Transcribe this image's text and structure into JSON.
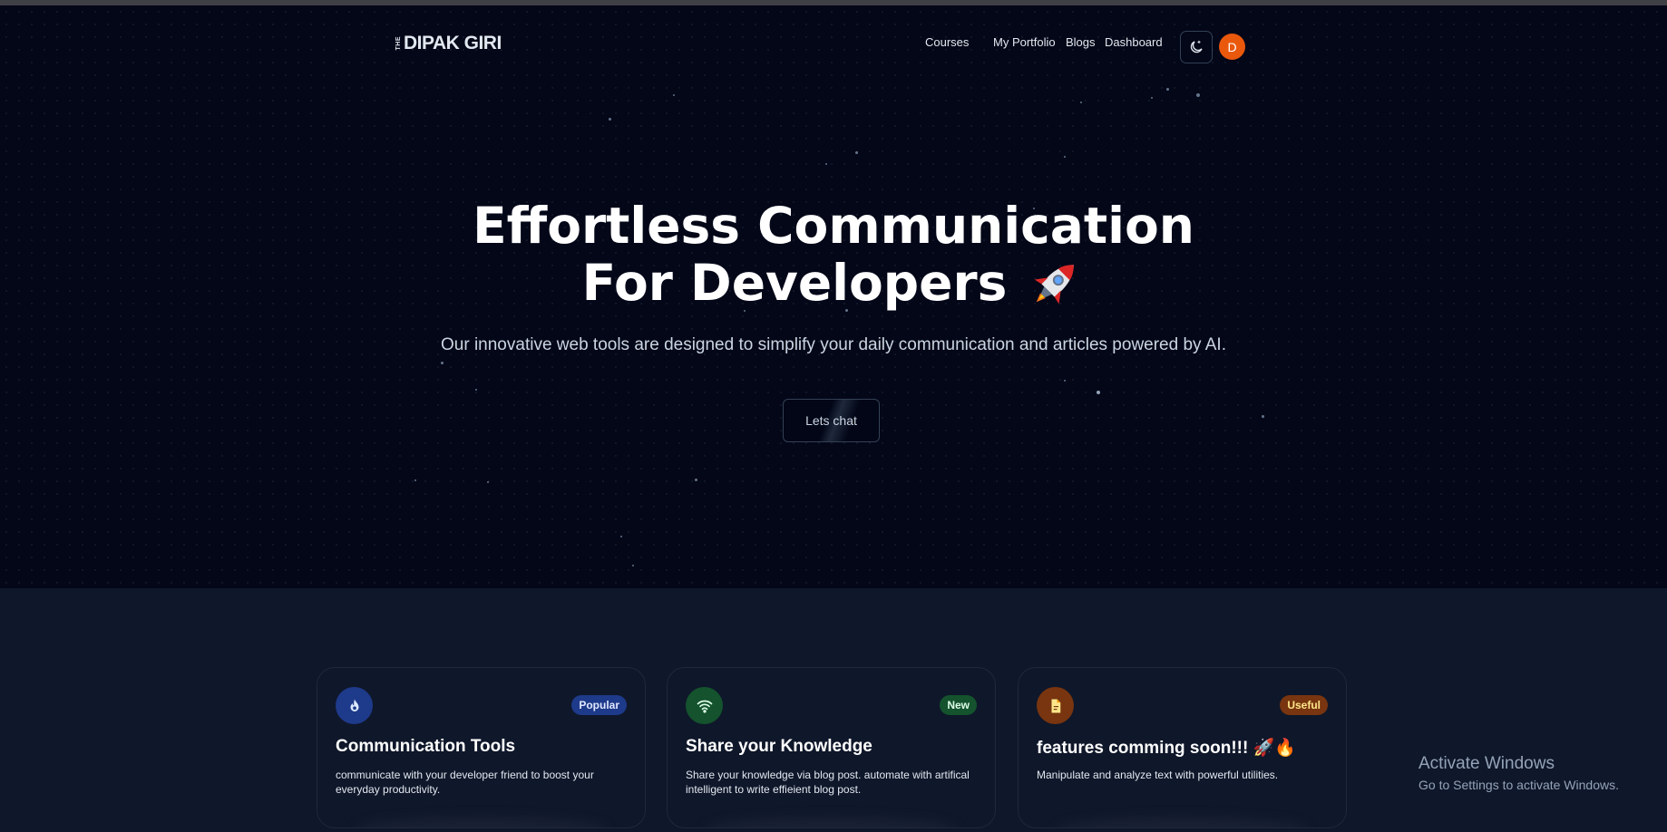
{
  "app": {
    "logo_prefix": "THE",
    "logo_text": "DIPAK GIRI"
  },
  "nav": {
    "links": [
      "Courses",
      "My Portfolio",
      "Blogs",
      "Dashboard"
    ],
    "theme_toggle_icon": "moon-icon",
    "avatar_initial": "D"
  },
  "hero": {
    "title_line1": "Effortless Communication",
    "title_line2": "For Developers",
    "title_emoji_icon": "rocket-icon",
    "subtitle": "Our innovative web tools are designed to simplify your daily communication and articles powered by AI.",
    "cta_label": "Lets chat"
  },
  "cards": [
    {
      "icon": "flame-icon",
      "icon_bg": "#1e3a8a",
      "badge": "Popular",
      "badge_bg": "#1e3a8a",
      "badge_color": "#e0e7ff",
      "title": "Communication Tools",
      "description": "communicate with your developer friend to boost your everyday productivity."
    },
    {
      "icon": "wifi-icon",
      "icon_bg": "#14532d",
      "badge": "New",
      "badge_bg": "#14532d",
      "badge_color": "#dcfce7",
      "title": "Share your Knowledge",
      "description": "Share your knowledge via blog post. automate with artifical intelligent to write effieient blog post."
    },
    {
      "icon": "document-icon",
      "icon_bg": "#78350f",
      "badge": "Useful",
      "badge_bg": "#78350f",
      "badge_color": "#fde68a",
      "title": "features comming soon!!! 🚀🔥",
      "description": "Manipulate and analyze text with powerful utilities."
    }
  ],
  "os_overlay": {
    "title": "Activate Windows",
    "subtitle": "Go to Settings to activate Windows."
  },
  "colors": {
    "hero_bg": "#030718",
    "section_bg": "#0f172a",
    "avatar_bg": "#ea580c"
  }
}
